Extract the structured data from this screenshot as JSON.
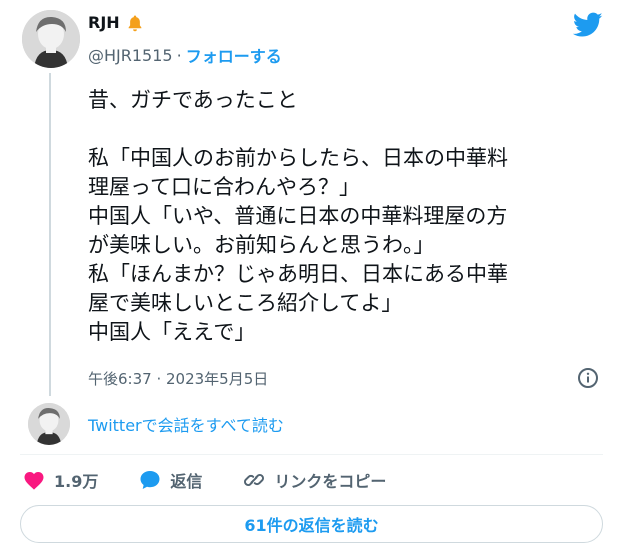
{
  "author": {
    "name": "RJH",
    "handle": "@HJR1515",
    "separator": "·",
    "follow_label": "フォローする"
  },
  "tweet": {
    "text": "昔、ガチであったこと\n\n私「中国人のお前からしたら、日本の中華料\n理屋って口に合わんやろ？」\n中国人「いや、普通に日本の中華料理屋の方\nが美味しい。お前知らんと思うわ。」\n私「ほんまか？じゃあ明日、日本にある中華\n屋で美味しいところ紹介してよ」\n中国人「ええで」",
    "timestamp": "午後6:37 · 2023年5月5日"
  },
  "conversation_link": "Twitterで会話をすべて読む",
  "actions": {
    "like_count": "1.9万",
    "reply_label": "返信",
    "copy_link_label": "リンクをコピー"
  },
  "replies_button": "61件の返信を読む",
  "icons": {
    "bell": "bell-icon",
    "twitter": "twitter-bird-icon",
    "info": "info-icon",
    "heart": "heart-icon",
    "reply": "speech-bubble-icon",
    "link": "link-icon"
  },
  "colors": {
    "accent": "#1d9bf0",
    "heart": "#f91880",
    "bell": "#f4a01c",
    "muted": "#536471"
  }
}
